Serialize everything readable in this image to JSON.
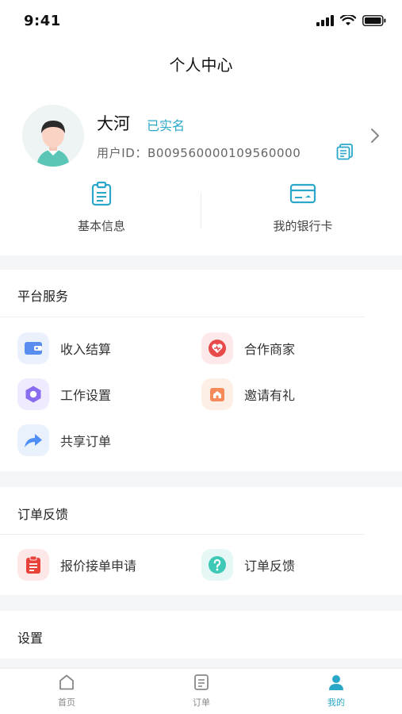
{
  "status_bar": {
    "time": "9:41"
  },
  "header": {
    "title": "个人中心"
  },
  "profile": {
    "name": "大河",
    "verified_label": "已实名",
    "user_id": "用户ID：B009560000109560000"
  },
  "quick_links": [
    {
      "label": "基本信息",
      "icon": "clipboard-icon"
    },
    {
      "label": "我的银行卡",
      "icon": "bank-card-icon"
    }
  ],
  "platform_services": {
    "title": "平台服务",
    "items": [
      {
        "label": "收入结算",
        "icon": "wallet-icon"
      },
      {
        "label": "合作商家",
        "icon": "heart-shield-icon"
      },
      {
        "label": "工作设置",
        "icon": "hexagon-settings-icon"
      },
      {
        "label": "邀请有礼",
        "icon": "gift-house-icon"
      },
      {
        "label": "共享订单",
        "icon": "share-arrow-icon"
      }
    ]
  },
  "order_feedback": {
    "title": "订单反馈",
    "items": [
      {
        "label": "报价接单申请",
        "icon": "clipboard-red-icon"
      },
      {
        "label": "订单反馈",
        "icon": "help-question-icon"
      }
    ]
  },
  "settings": {
    "title": "设置"
  },
  "tabbar": {
    "items": [
      {
        "label": "首页",
        "icon": "home-icon",
        "active": false
      },
      {
        "label": "订单",
        "icon": "order-list-icon",
        "active": false
      },
      {
        "label": "我的",
        "icon": "user-icon",
        "active": true
      }
    ]
  },
  "colors": {
    "accent": "#2aa7c9",
    "section_gap": "#f4f5f7",
    "wallet": "#5a8df0",
    "merchant": "#e84a4a",
    "work_settings": "#8a6cf0",
    "invite": "#f58a5a",
    "share": "#4e8ef7",
    "quote": "#e8413a",
    "feedback": "#3ec9b6"
  }
}
